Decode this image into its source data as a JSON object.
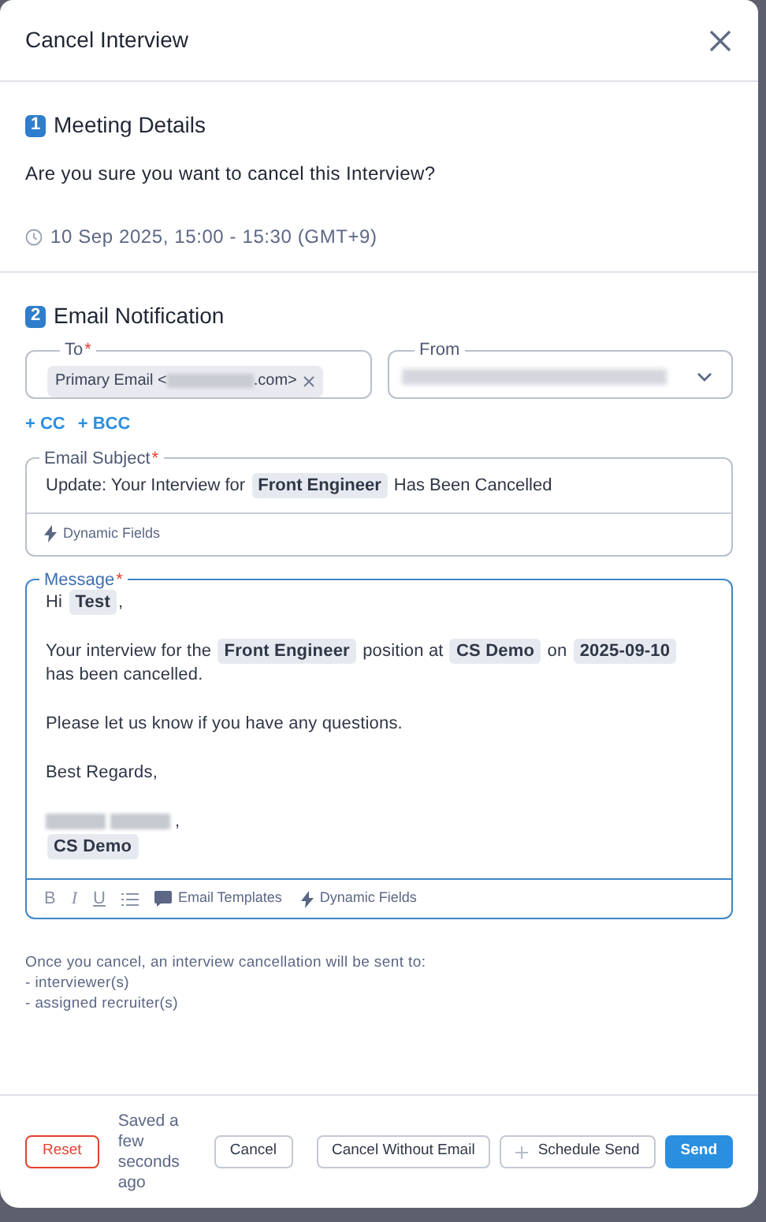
{
  "dialog": {
    "title": "Cancel Interview"
  },
  "meeting": {
    "step": "1",
    "heading": "Meeting Details",
    "question": "Are you sure you want to cancel this Interview?",
    "time": "10 Sep 2025, 15:00 - 15:30 (GMT+9)"
  },
  "email": {
    "step": "2",
    "heading": "Email Notification",
    "to": {
      "label": "To",
      "required_mark": "*",
      "chips": [
        {
          "prefix": "Primary Email <",
          "suffix": ".com>",
          "redacted": true
        }
      ]
    },
    "from": {
      "label": "From",
      "redacted": true
    },
    "links": [
      "+ CC",
      "+ BCC"
    ],
    "subject": {
      "label": "Email Subject",
      "required_mark": "*",
      "segments": [
        {
          "kind": "text",
          "text": "Update: Your Interview for "
        },
        {
          "kind": "chip",
          "text": "Front Engineer"
        },
        {
          "kind": "text",
          "text": " Has Been Cancelled"
        }
      ],
      "tool": "Dynamic Fields"
    },
    "message": {
      "label": "Message",
      "required_mark": "*",
      "focused": true,
      "paragraphs": [
        [
          [
            {
              "kind": "text",
              "text": "Hi "
            },
            {
              "kind": "chip",
              "text": "Test"
            },
            {
              "kind": "text",
              "text": ","
            }
          ]
        ],
        [
          [
            {
              "kind": "text",
              "text": "Your interview for the "
            },
            {
              "kind": "chip",
              "text": "Front Engineer"
            },
            {
              "kind": "text",
              "text": " position at "
            },
            {
              "kind": "chip",
              "text": "CS Demo"
            },
            {
              "kind": "text",
              "text": " on "
            },
            {
              "kind": "chip",
              "text": "2025-09-10"
            }
          ],
          [
            {
              "kind": "text",
              "text": "has been cancelled."
            }
          ]
        ],
        [
          [
            {
              "kind": "text",
              "text": "Please let us know if you have any questions."
            }
          ]
        ],
        [
          [
            {
              "kind": "text",
              "text": "Best Regards,"
            }
          ]
        ],
        [
          [
            {
              "kind": "redacted"
            },
            {
              "kind": "redacted"
            },
            {
              "kind": "text",
              "text": ","
            }
          ],
          [
            {
              "kind": "chip",
              "text": "CS Demo"
            }
          ]
        ]
      ],
      "toolbar": [
        {
          "kind": "bold",
          "label": "B"
        },
        {
          "kind": "italic",
          "label": "I"
        },
        {
          "kind": "underline",
          "label": "U"
        },
        {
          "kind": "list"
        },
        {
          "kind": "templates",
          "label": "Email Templates"
        },
        {
          "kind": "dynamic",
          "label": "Dynamic Fields"
        }
      ]
    }
  },
  "note": [
    "Once you cancel, an interview cancellation will be sent to:",
    "- interviewer(s)",
    "- assigned recruiter(s)"
  ],
  "footer": {
    "reset": "Reset",
    "saved": "Saved a few seconds ago",
    "buttons": [
      {
        "kind": "plain",
        "label": "Cancel"
      },
      {
        "kind": "plain",
        "label": "Cancel Without Email"
      },
      {
        "kind": "schedule",
        "label": "Schedule Send"
      },
      {
        "kind": "primary",
        "label": "Send"
      }
    ]
  }
}
